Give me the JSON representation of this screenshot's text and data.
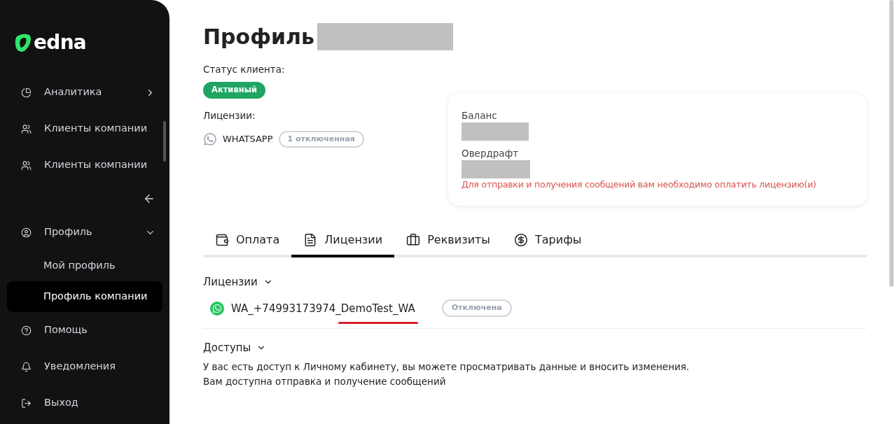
{
  "sidebar": {
    "logo": "edna",
    "items": [
      {
        "kind": "group",
        "label": "Аналитика",
        "expanded": false
      },
      {
        "kind": "link",
        "label": "Клиенты компании"
      },
      {
        "kind": "link",
        "label": "Клиенты компании"
      },
      {
        "kind": "collapse"
      },
      {
        "kind": "group",
        "label": "Профиль",
        "expanded": true,
        "children": [
          {
            "label": "Мой профиль",
            "selected": false
          },
          {
            "label": "Профиль компании",
            "selected": true
          }
        ]
      },
      {
        "kind": "link",
        "label": "Помощь"
      },
      {
        "kind": "link",
        "label": "Уведомления"
      },
      {
        "kind": "link",
        "label": "Выход"
      }
    ]
  },
  "page": {
    "title": "Профиль",
    "status_label": "Статус клиента:",
    "status": "Активный",
    "licenses_label": "Лицензии:",
    "license_channel": "WHATSAPP",
    "license_badge": "1 отключенная",
    "balance_card": {
      "balance_label": "Баланс",
      "overdraft_label": "Овердрафт",
      "warning": "Для отправки и получения сообщений вам необходимо оплатить лицензию(и)"
    },
    "tabs": [
      {
        "label": "Оплата",
        "selected": false
      },
      {
        "label": "Лицензии",
        "selected": true
      },
      {
        "label": "Реквизиты",
        "selected": false
      },
      {
        "label": "Тарифы",
        "selected": false
      }
    ],
    "licenses_section": {
      "title": "Лицензии",
      "expanded": true,
      "rows": [
        {
          "name": "WA_+74993173974_DemoTest_WA",
          "status": "Отключена"
        }
      ]
    },
    "access_section": {
      "title": "Доступы",
      "expanded": true,
      "lines": [
        "У вас есть доступ к Личному кабинету, вы можете просматривать данные и вносить изменения.",
        "Вам доступна отправка и получение сообщений"
      ]
    }
  }
}
